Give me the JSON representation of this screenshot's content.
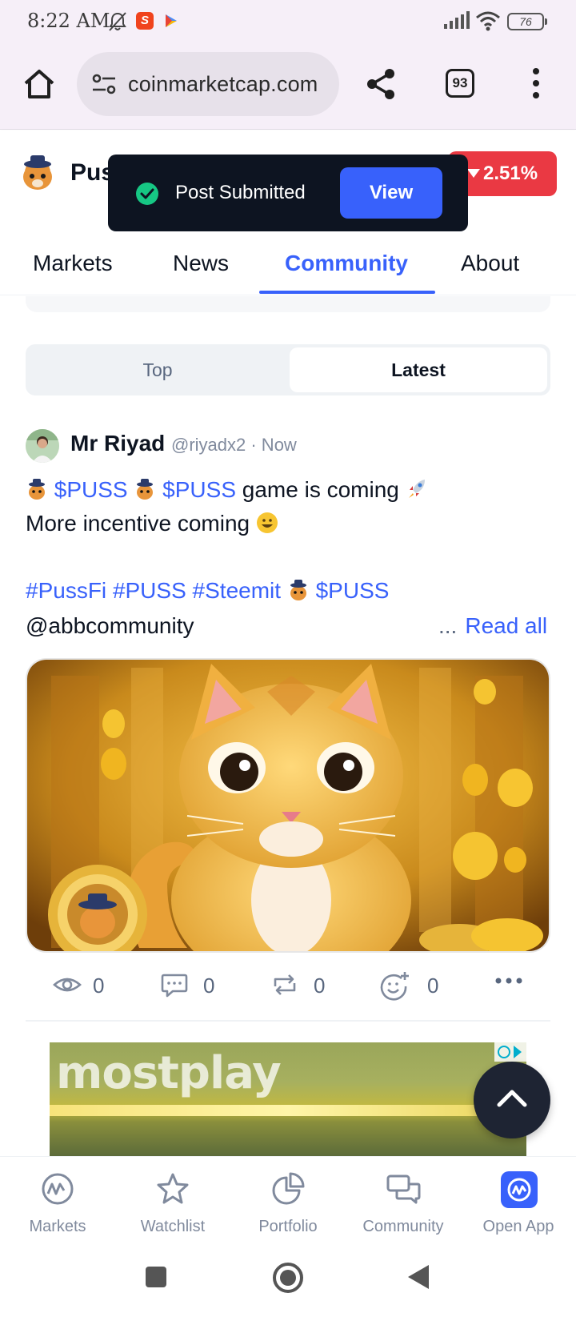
{
  "status_bar": {
    "time": "8:22 AM",
    "battery": "76",
    "icons": [
      "mute-bell-icon",
      "app-s-icon",
      "play-games-icon",
      "signal-icon",
      "wifi-icon",
      "battery-icon"
    ]
  },
  "browser": {
    "url": "coinmarketcap.com",
    "tab_count": "93",
    "icons": [
      "home-icon",
      "site-settings-icon",
      "share-icon",
      "tabs-icon",
      "menu-dots-icon"
    ]
  },
  "coin": {
    "name": "Pus",
    "price_change": "2.51%",
    "price_change_direction": "down",
    "colors": {
      "negative": "#ea3943",
      "accent": "#3861fb"
    }
  },
  "toast": {
    "message": "Post Submitted",
    "action": "View"
  },
  "tabs": {
    "items": [
      "Markets",
      "News",
      "Community",
      "About"
    ],
    "active": "Community"
  },
  "feed_filter": {
    "top": "Top",
    "latest": "Latest",
    "active": "Latest"
  },
  "post": {
    "author": "Mr Riyad",
    "handle_time": "@riyadx2 · Now",
    "line1": {
      "ticker1": "$PUSS",
      "ticker2": "$PUSS",
      "text": "game is coming"
    },
    "line2": "More incentive coming",
    "line3": {
      "tag1": "#PussFi",
      "tag2": "#PUSS",
      "tag3": "#Steemit",
      "ticker": "$PUSS"
    },
    "line4": "@abbcommunity",
    "read_more_dots": "...",
    "read_more": "Read all",
    "stats": {
      "views": "0",
      "comments": "0",
      "reposts": "0",
      "reactions": "0"
    }
  },
  "ad": {
    "brand": "mostplay"
  },
  "bottom_nav": {
    "items": [
      {
        "label": "Markets",
        "icon": "markets-icon"
      },
      {
        "label": "Watchlist",
        "icon": "star-icon"
      },
      {
        "label": "Portfolio",
        "icon": "pie-chart-icon"
      },
      {
        "label": "Community",
        "icon": "chat-bubbles-icon"
      },
      {
        "label": "Open App",
        "icon": "cmc-logo-icon"
      }
    ]
  }
}
